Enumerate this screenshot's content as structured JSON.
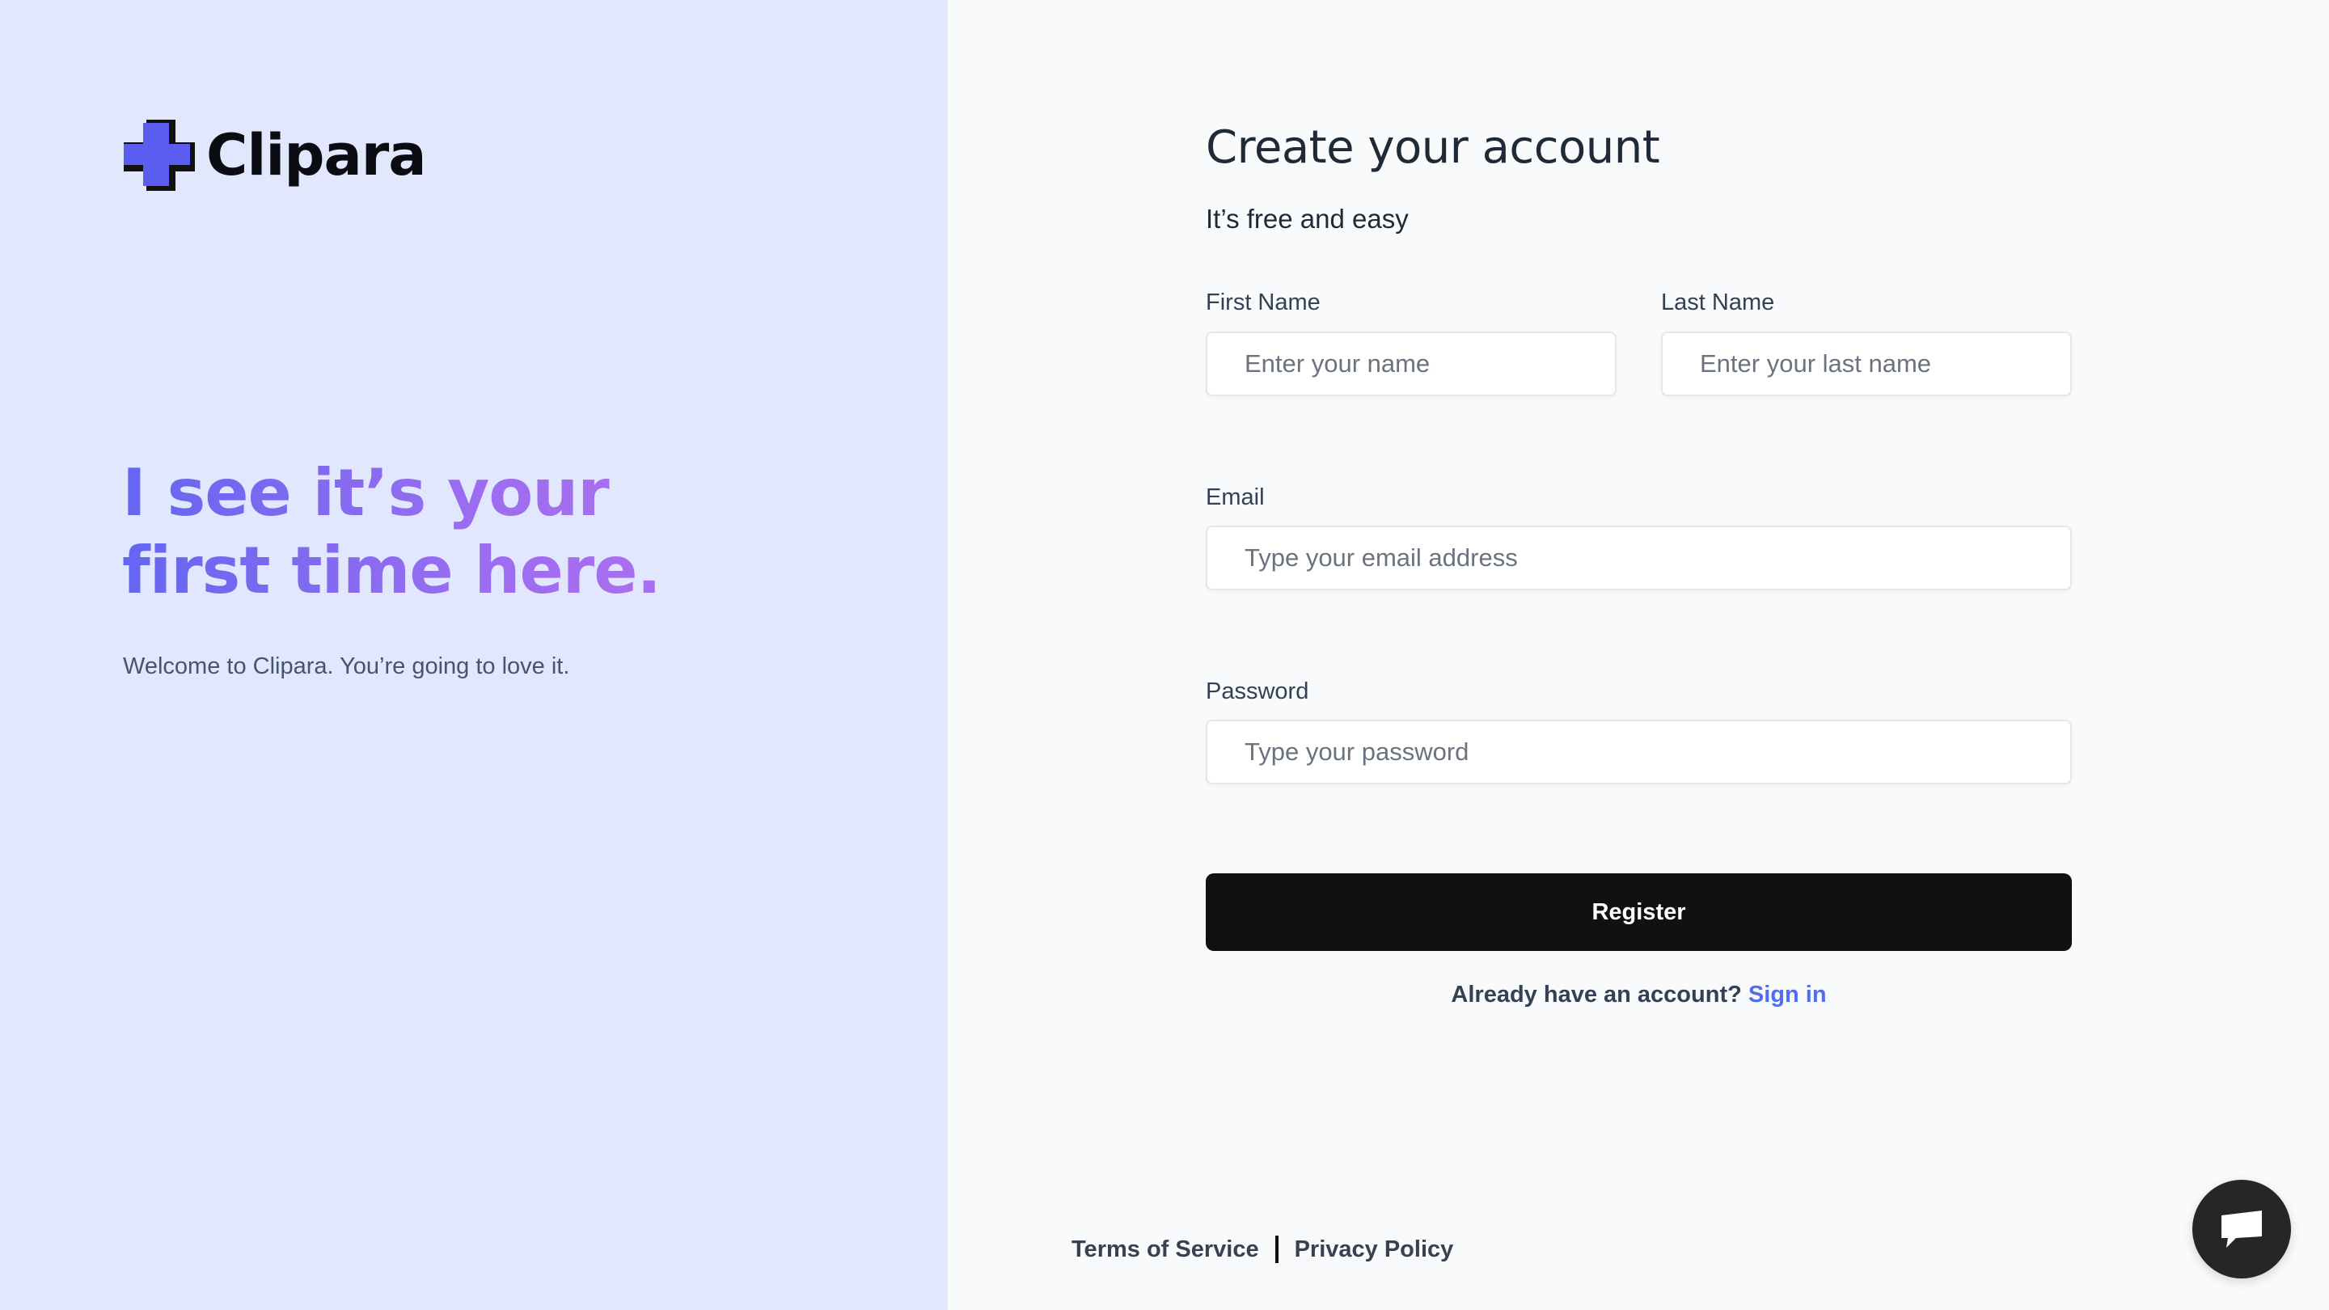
{
  "brand": {
    "name": "Clipara",
    "mark_color": "#5b5cf0"
  },
  "hero": {
    "title": "I see it’s your first time here.",
    "subtitle": "Welcome to Clipara. You’re going to love it."
  },
  "form": {
    "title": "Create your account",
    "subtitle": "It’s free and easy",
    "first_name": {
      "label": "First Name",
      "placeholder": "Enter your name",
      "value": ""
    },
    "last_name": {
      "label": "Last Name",
      "placeholder": "Enter your last name",
      "value": ""
    },
    "email": {
      "label": "Email",
      "placeholder": "Type your email address",
      "value": ""
    },
    "password": {
      "label": "Password",
      "placeholder": "Type your password",
      "value": ""
    },
    "register_label": "Register",
    "signin_prompt": "Already have an account?",
    "signin_link": "Sign in"
  },
  "footer": {
    "terms": "Terms of Service",
    "privacy": "Privacy Policy"
  },
  "chat": {
    "icon": "chat-bubble-icon"
  },
  "colors": {
    "left_panel_bg": "#e1e7fd",
    "accent_gradient_start": "#6366f1",
    "accent_gradient_end": "#b66ef0",
    "button_bg": "#111111",
    "link": "#4f6ef0"
  }
}
